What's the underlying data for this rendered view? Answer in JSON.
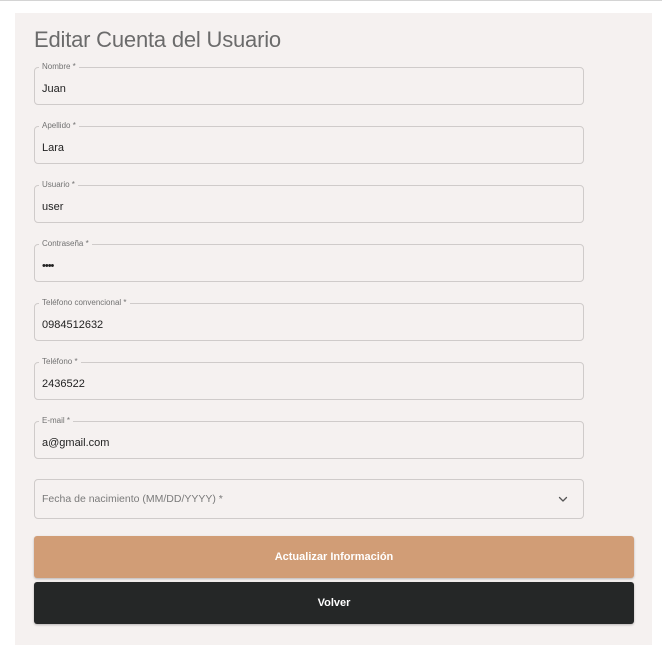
{
  "form": {
    "title": "Editar Cuenta del Usuario",
    "fields": [
      {
        "label": "Nombre *",
        "value": "Juan",
        "type": "text"
      },
      {
        "label": "Apellido *",
        "value": "Lara",
        "type": "text"
      },
      {
        "label": "Usuario *",
        "value": "user",
        "type": "text"
      },
      {
        "label": "Contraseña *",
        "value": "••••",
        "type": "password"
      },
      {
        "label": "Teléfono convencional *",
        "value": "0984512632",
        "type": "text"
      },
      {
        "label": "Teléfono *",
        "value": "2436522",
        "type": "text"
      },
      {
        "label": "E-mail *",
        "value": "a@gmail.com",
        "type": "text"
      }
    ],
    "birthdate": {
      "placeholder": "Fecha de nacimiento (MM/DD/YYYY) *",
      "icon": "chevron-down-icon"
    },
    "buttons": {
      "update_label": "Actualizar Información",
      "back_label": "Volver"
    }
  },
  "colors": {
    "card_bg": "#f5f1f0",
    "primary": "#d19d76",
    "secondary": "#252727",
    "title": "#6b6b6b"
  }
}
